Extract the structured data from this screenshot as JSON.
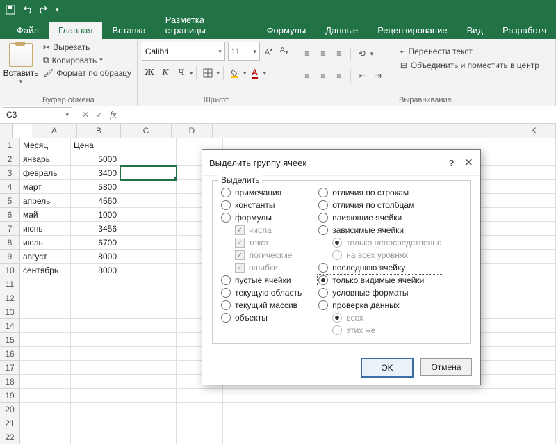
{
  "tabs": {
    "file": "Файл",
    "home": "Главная",
    "insert": "Вставка",
    "layout": "Разметка страницы",
    "formulas": "Формулы",
    "data": "Данные",
    "review": "Рецензирование",
    "view": "Вид",
    "dev": "Разработч"
  },
  "clipboard": {
    "paste": "Вставить",
    "cut": "Вырезать",
    "copy": "Копировать",
    "painter": "Формат по образцу",
    "group": "Буфер обмена"
  },
  "font": {
    "name": "Calibri",
    "size": "11",
    "group": "Шрифт",
    "bold": "Ж",
    "italic": "К",
    "underline": "Ч"
  },
  "align": {
    "group": "Выравнивание",
    "wrap": "Перенести текст",
    "merge": "Объединить и поместить в центр"
  },
  "namebox": "C3",
  "colheads": [
    "A",
    "B",
    "C",
    "D",
    "K"
  ],
  "tableHeader": {
    "a": "Месяц",
    "b": "Цена"
  },
  "rows": [
    {
      "a": "январь",
      "b": "5000"
    },
    {
      "a": "февраль",
      "b": "3400"
    },
    {
      "a": "март",
      "b": "5800"
    },
    {
      "a": "апрель",
      "b": "4560"
    },
    {
      "a": "май",
      "b": "1000"
    },
    {
      "a": "июнь",
      "b": "3456"
    },
    {
      "a": "июль",
      "b": "6700"
    },
    {
      "a": "август",
      "b": "8000"
    },
    {
      "a": "сентябрь",
      "b": "8000"
    }
  ],
  "dialog": {
    "title": "Выделить группу ячеек",
    "group": "Выделить",
    "left": [
      "примечания",
      "константы",
      "формулы"
    ],
    "formulasSub": [
      "числа",
      "текст",
      "логические",
      "ошибки"
    ],
    "left2": [
      "пустые ячейки",
      "текущую область",
      "текущий массив",
      "объекты"
    ],
    "right": [
      "отличия по строкам",
      "отличия по столбцам",
      "влияющие ячейки",
      "зависимые ячейки"
    ],
    "depSub": [
      "только непосредственно",
      "на всех уровнях"
    ],
    "right2": [
      "последнюю ячейку",
      "только видимые ячейки",
      "условные форматы",
      "проверка данных"
    ],
    "dataSub": [
      "всех",
      "этих же"
    ],
    "ok": "OK",
    "cancel": "Отмена"
  }
}
